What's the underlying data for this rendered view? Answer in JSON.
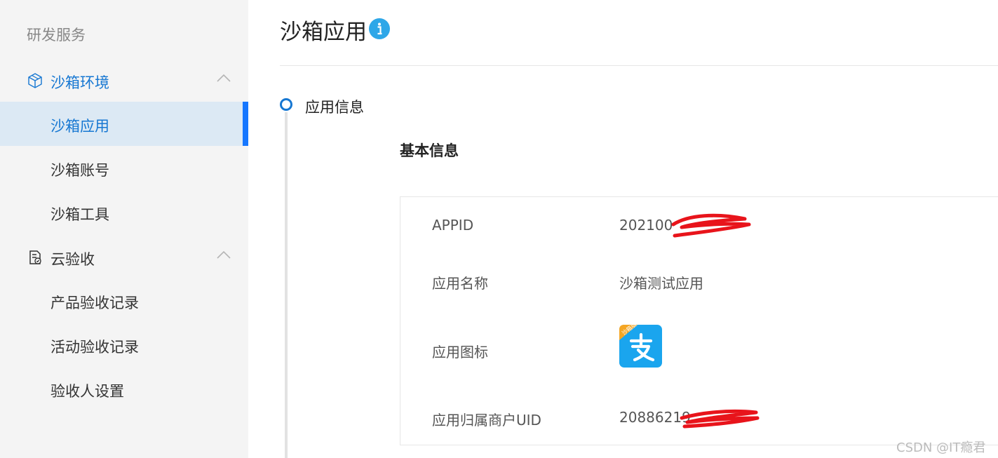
{
  "sidebar": {
    "section_title": "研发服务",
    "groups": [
      {
        "label": "沙箱环境",
        "icon": "box-icon",
        "expanded": true,
        "items": [
          {
            "label": "沙箱应用",
            "active": true
          },
          {
            "label": "沙箱账号",
            "active": false
          },
          {
            "label": "沙箱工具",
            "active": false
          }
        ]
      },
      {
        "label": "云验收",
        "icon": "document-check-icon",
        "expanded": true,
        "items": [
          {
            "label": "产品验收记录",
            "active": false
          },
          {
            "label": "活动验收记录",
            "active": false
          },
          {
            "label": "验收人设置",
            "active": false
          }
        ]
      }
    ]
  },
  "main": {
    "title": "沙箱应用",
    "title_icon": "info-icon",
    "step": {
      "label": "应用信息"
    },
    "section_title": "基本信息",
    "rows": [
      {
        "label": "APPID",
        "value": "202100"
      },
      {
        "label": "应用名称",
        "value": "沙箱测试应用"
      },
      {
        "label": "应用图标",
        "value": "",
        "icon": "alipay-icon",
        "badge": "沙箱版"
      },
      {
        "label": "应用归属商户UID",
        "value": "20886219"
      }
    ]
  },
  "watermark": "CSDN @IT瘾君",
  "colors": {
    "accent": "#1677d2",
    "active_bg": "#dce9f4",
    "active_bar": "#1677ff",
    "sidebar_bg": "#f4f4f4",
    "info_icon": "#2ea7e8",
    "alipay_blue": "#1aa5ee",
    "alipay_badge": "#f5a623",
    "redaction": "#e8141b"
  }
}
